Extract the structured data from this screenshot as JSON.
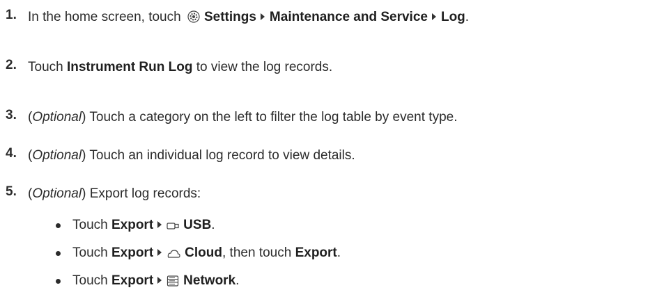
{
  "steps": [
    {
      "num": "1.",
      "pre": "In the home screen, touch",
      "bold1": "Settings",
      "bold2": "Maintenance and Service",
      "bold3": "Log",
      "post": "."
    },
    {
      "num": "2.",
      "pre": "Touch",
      "bold": "Instrument Run Log",
      "post": "to view the log records."
    },
    {
      "num": "3.",
      "open": "(",
      "italic": "Optional",
      "close": ")",
      "text": "Touch a category on the left to filter the log table by event type."
    },
    {
      "num": "4.",
      "open": "(",
      "italic": "Optional",
      "close": ")",
      "text": "Touch an individual log record to view details."
    },
    {
      "num": "5.",
      "open": "(",
      "italic": "Optional",
      "close": ")",
      "text": "Export log records:"
    }
  ],
  "bullets": [
    {
      "pre": "Touch",
      "bold1": "Export",
      "icon": "usb-icon",
      "bold2": "USB",
      "post": "."
    },
    {
      "pre": "Touch",
      "bold1": "Export",
      "icon": "cloud-icon",
      "bold2": "Cloud",
      "mid": ", then touch",
      "bold3": "Export",
      "post": "."
    },
    {
      "pre": "Touch",
      "bold1": "Export",
      "icon": "network-icon",
      "bold2": "Network",
      "post": "."
    }
  ]
}
